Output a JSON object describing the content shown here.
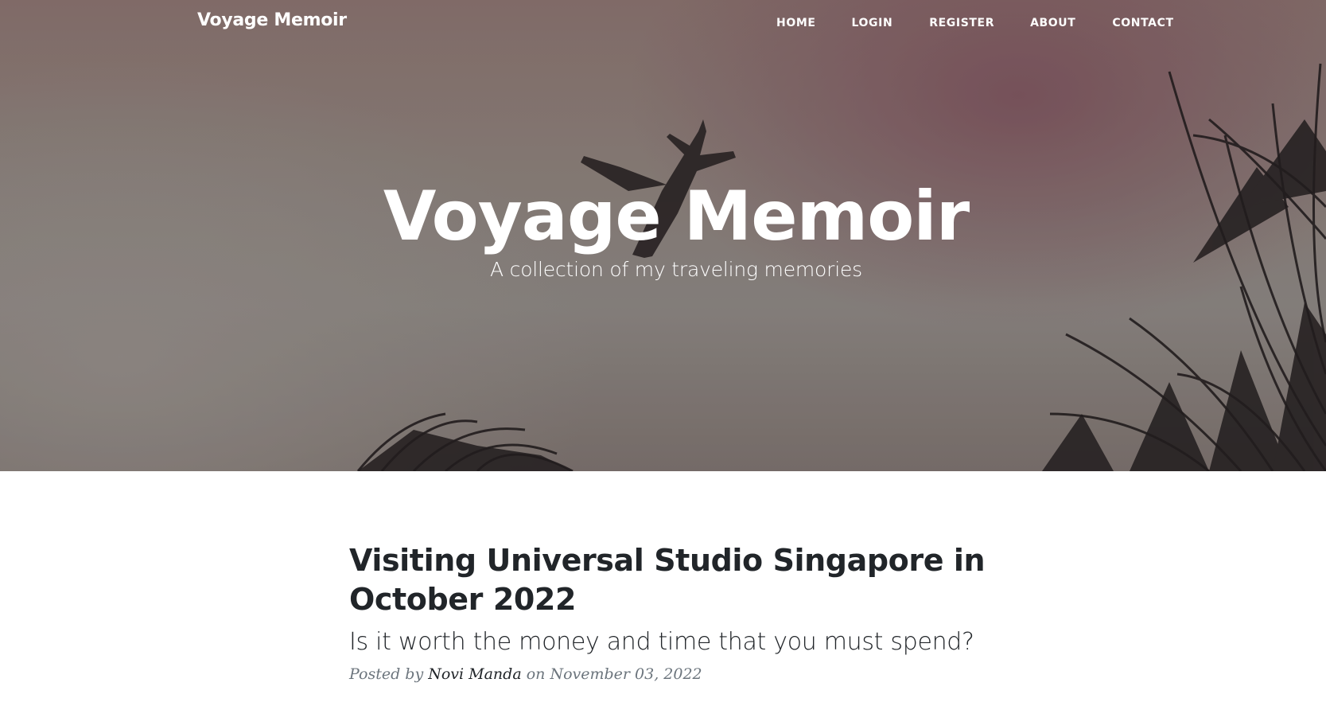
{
  "nav": {
    "brand": "Voyage Memoir",
    "links": {
      "home": "HOME",
      "login": "LOGIN",
      "register": "REGISTER",
      "about": "ABOUT",
      "contact": "CONTACT"
    }
  },
  "header": {
    "title": "Voyage Memoir",
    "subtitle": "A collection of my traveling memories"
  },
  "posts": [
    {
      "title": "Visiting Universal Studio Singapore in October 2022",
      "subtitle": "Is it worth the money and time that you must spend?",
      "meta_prefix": "Posted by",
      "author": "Novi Manda",
      "meta_on": "on",
      "date": "November 03, 2022"
    }
  ],
  "colors": {
    "heading_text": "#ffffff",
    "body_text": "#212529",
    "meta_text": "#6c757d"
  }
}
